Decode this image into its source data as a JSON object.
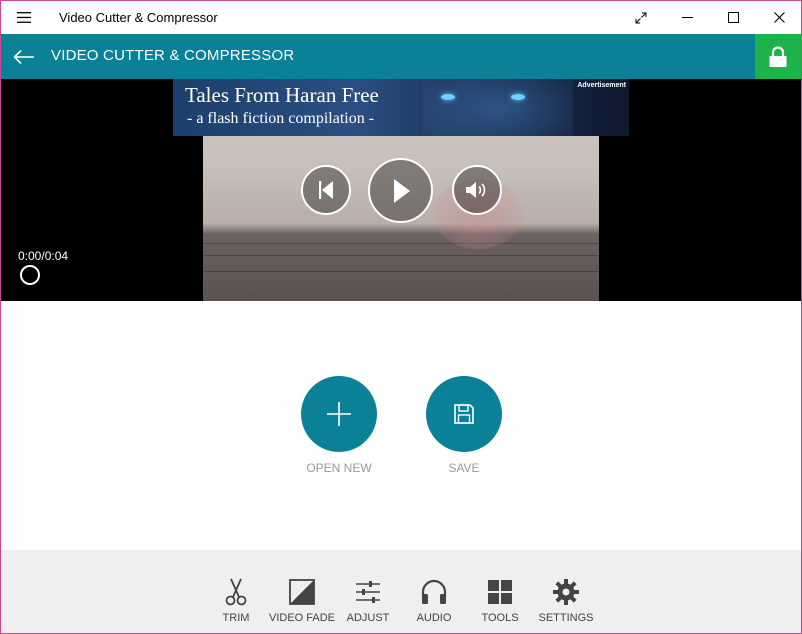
{
  "window": {
    "title": "Video Cutter & Compressor",
    "icons": {
      "menu": "hamburger-icon",
      "fullscreen": "fullscreen-icon",
      "minimize": "minimize-icon",
      "maximize": "maximize-icon",
      "close": "close-icon"
    }
  },
  "appbar": {
    "title": "VIDEO CUTTER & COMPRESSOR",
    "back_icon": "back-arrow-icon",
    "lock_icon": "lock-icon",
    "color": "#0a8197",
    "lock_color": "#1db34a"
  },
  "ad": {
    "title": "Tales From Haran Free",
    "subtitle": "- a flash fiction compilation -",
    "label": "Advertisement"
  },
  "player": {
    "timecode": "0:00/0:04",
    "progress": 0,
    "controls": [
      "previous-icon",
      "play-icon",
      "volume-icon"
    ]
  },
  "actions": {
    "open_new": "OPEN NEW",
    "save": "SAVE"
  },
  "toolbar": {
    "items": [
      {
        "label": "TRIM",
        "icon": "scissors-icon"
      },
      {
        "label": "VIDEO FADE",
        "icon": "fade-icon"
      },
      {
        "label": "ADJUST",
        "icon": "sliders-icon"
      },
      {
        "label": "AUDIO",
        "icon": "headphones-icon"
      },
      {
        "label": "TOOLS",
        "icon": "grid-icon"
      },
      {
        "label": "SETTINGS",
        "icon": "gear-icon"
      }
    ]
  }
}
